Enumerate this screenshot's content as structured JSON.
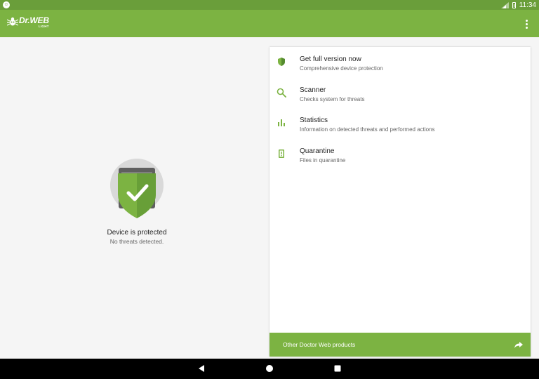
{
  "status_bar": {
    "time": "11:34",
    "icons": [
      "notification-icon",
      "signal-icon",
      "battery-icon"
    ]
  },
  "app_bar": {
    "logo_text": "Dr.WEB",
    "logo_subtext": "LIGHT",
    "background_color": "#7cb342"
  },
  "protection": {
    "title": "Device is protected",
    "subtitle": "No threats detected.",
    "shield_color": "#7cb342"
  },
  "menu": {
    "items": [
      {
        "title": "Get full version now",
        "description": "Comprehensive device protection",
        "icon": "shield-icon"
      },
      {
        "title": "Scanner",
        "description": "Checks system for threats",
        "icon": "search-icon"
      },
      {
        "title": "Statistics",
        "description": "Information on detected threats and performed actions",
        "icon": "bar-chart-icon"
      },
      {
        "title": "Quarantine",
        "description": "Files in quarantine",
        "icon": "quarantine-icon"
      }
    ]
  },
  "footer": {
    "label": "Other Doctor Web products",
    "icon": "share-icon"
  },
  "nav_bar": {
    "buttons": [
      "back",
      "home",
      "recents"
    ]
  }
}
